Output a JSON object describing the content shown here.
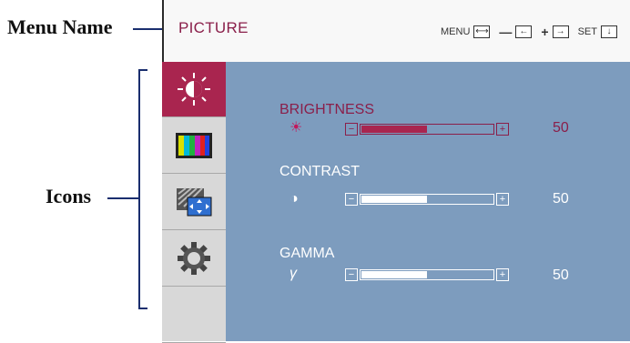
{
  "callouts": {
    "menu_name": "Menu Name",
    "icons": "Icons"
  },
  "osd": {
    "menu_name": "PICTURE",
    "controls": [
      {
        "label": "MENU",
        "key": "⟷",
        "icon": "menu-key-icon"
      },
      {
        "label": "—",
        "key": "←",
        "icon": "minus-key-icon"
      },
      {
        "label": "+",
        "key": "→",
        "icon": "plus-key-icon"
      },
      {
        "label": "SET",
        "key": "↓",
        "icon": "set-key-icon"
      }
    ],
    "sidebar": [
      {
        "icon": "brightness-icon",
        "active": true
      },
      {
        "icon": "color-bars-icon",
        "active": false
      },
      {
        "icon": "screen-position-icon",
        "active": false
      },
      {
        "icon": "settings-gear-icon",
        "active": false
      },
      {
        "icon": "empty-slot",
        "active": false
      }
    ],
    "rows": [
      {
        "label": "BRIGHTNESS",
        "symbol": "☀",
        "value": "50",
        "level_pct": 50,
        "active": true
      },
      {
        "label": "CONTRAST",
        "symbol": "◑",
        "value": "50",
        "level_pct": 50,
        "active": false
      },
      {
        "label": "GAMMA",
        "symbol": "γ",
        "value": "50",
        "level_pct": 50,
        "active": false
      }
    ]
  },
  "colors": {
    "accent": "#a9254f",
    "panel_bg": "#7d9cbe",
    "sidebar_bg": "#d8d8d8",
    "callout_line": "#1a2e6e"
  }
}
